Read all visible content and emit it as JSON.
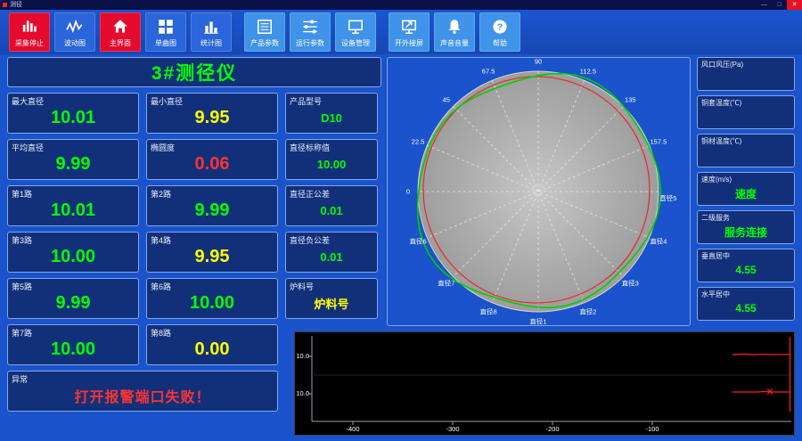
{
  "window": {
    "title": "测径",
    "minimize": "—",
    "maximize": "□",
    "close": "✕"
  },
  "toolbar": {
    "buttons": [
      {
        "label": "采集停止",
        "icon": "collect-stop-icon",
        "variant": "red",
        "gap": false
      },
      {
        "label": "波动图",
        "icon": "wave-chart-icon",
        "variant": "blue",
        "gap": false
      },
      {
        "label": "主界面",
        "icon": "home-icon",
        "variant": "red",
        "gap": false
      },
      {
        "label": "单曲图",
        "icon": "single-chart-icon",
        "variant": "blue",
        "gap": false
      },
      {
        "label": "统计图",
        "icon": "stats-chart-icon",
        "variant": "blue",
        "gap": false
      },
      {
        "label": "产品参数",
        "icon": "product-params-icon",
        "variant": "light",
        "gap": true
      },
      {
        "label": "运行参数",
        "icon": "run-params-icon",
        "variant": "light",
        "gap": false
      },
      {
        "label": "设备管理",
        "icon": "device-manage-icon",
        "variant": "light",
        "gap": false
      },
      {
        "label": "开外接屏",
        "icon": "external-screen-icon",
        "variant": "light",
        "gap": true
      },
      {
        "label": "声音音量",
        "icon": "sound-volume-icon",
        "variant": "light",
        "gap": false
      },
      {
        "label": "帮助",
        "icon": "help-icon",
        "variant": "light",
        "gap": false
      }
    ]
  },
  "gauge_panel": {
    "title": "3#测径仪",
    "fields": [
      {
        "label": "最大直径",
        "value": "10.01",
        "color": "green",
        "size": "large"
      },
      {
        "label": "最小直径",
        "value": "9.95",
        "color": "yellow",
        "size": "large"
      },
      {
        "label": "产品型号",
        "value": "D10",
        "color": "green",
        "size": "small"
      },
      {
        "label": "平均直径",
        "value": "9.99",
        "color": "green",
        "size": "large"
      },
      {
        "label": "椭圆度",
        "value": "0.06",
        "color": "red",
        "size": "large"
      },
      {
        "label": "直径标称值",
        "value": "10.00",
        "color": "green",
        "size": "small"
      },
      {
        "label": "第1路",
        "value": "10.01",
        "color": "green",
        "size": "large"
      },
      {
        "label": "第2路",
        "value": "9.99",
        "color": "green",
        "size": "large"
      },
      {
        "label": "直径正公差",
        "value": "0.01",
        "color": "green",
        "size": "small"
      },
      {
        "label": "第3路",
        "value": "10.00",
        "color": "green",
        "size": "large"
      },
      {
        "label": "第4路",
        "value": "9.95",
        "color": "yellow",
        "size": "large"
      },
      {
        "label": "直径负公差",
        "value": "0.01",
        "color": "green",
        "size": "small"
      },
      {
        "label": "第5路",
        "value": "9.99",
        "color": "green",
        "size": "large"
      },
      {
        "label": "第6路",
        "value": "10.00",
        "color": "green",
        "size": "large"
      },
      {
        "label": "炉料号",
        "value": "炉料号",
        "color": "yellow",
        "size": "small"
      },
      {
        "label": "第7路",
        "value": "10.00",
        "color": "green",
        "size": "large"
      },
      {
        "label": "第8路",
        "value": "0.00",
        "color": "yellow",
        "size": "large"
      },
      {
        "label": "异常",
        "value": "打开报警端口失败！",
        "color": "red",
        "size": "alarm"
      }
    ]
  },
  "polar_chart": {
    "angle_labels": [
      {
        "text": "0",
        "deg": 180
      },
      {
        "text": "22.5",
        "deg": 157.5
      },
      {
        "text": "45",
        "deg": 135
      },
      {
        "text": "67.5",
        "deg": 112.5
      },
      {
        "text": "90",
        "deg": 90
      },
      {
        "text": "112.5",
        "deg": 67.5
      },
      {
        "text": "135",
        "deg": 45
      },
      {
        "text": "157.5",
        "deg": 22.5
      }
    ],
    "diameter_labels": [
      {
        "text": "直径1",
        "deg": 270
      },
      {
        "text": "直径2",
        "deg": 292.5
      },
      {
        "text": "直径3",
        "deg": 315
      },
      {
        "text": "直径4",
        "deg": 337.5
      },
      {
        "text": "直径5",
        "deg": 357
      },
      {
        "text": "直径6",
        "deg": 202.5
      },
      {
        "text": "直径7",
        "deg": 225
      },
      {
        "text": "直径8",
        "deg": 247.5
      }
    ],
    "colors": {
      "disc": "#adadad",
      "measured": "#00cf00",
      "nominal": "#e23030"
    }
  },
  "right_panel": {
    "fields": [
      {
        "label": "风口风压(Pa)",
        "value": ""
      },
      {
        "label": "铜套温度(℃)",
        "value": ""
      },
      {
        "label": "铜材温度(℃)",
        "value": ""
      },
      {
        "label": "速度(m/s)",
        "value": "速度"
      },
      {
        "label": "二级服务",
        "value": "服务连接"
      },
      {
        "label": "垂直居中",
        "value": "4.55"
      },
      {
        "label": "水平居中",
        "value": "4.55"
      }
    ]
  },
  "bottom_chart": {
    "y_ticks": [
      "10.0",
      "10.0"
    ],
    "x_ticks": [
      "-400",
      "-300",
      "-200",
      "-100"
    ]
  },
  "colors": {
    "background": "#1a53cb",
    "panel_bg": "#12307a",
    "panel_border": "#7fa8e8",
    "value_green": "#00ff00",
    "value_yellow": "#ffff00",
    "value_red": "#ff3232",
    "button_red": "#e60a2e"
  }
}
